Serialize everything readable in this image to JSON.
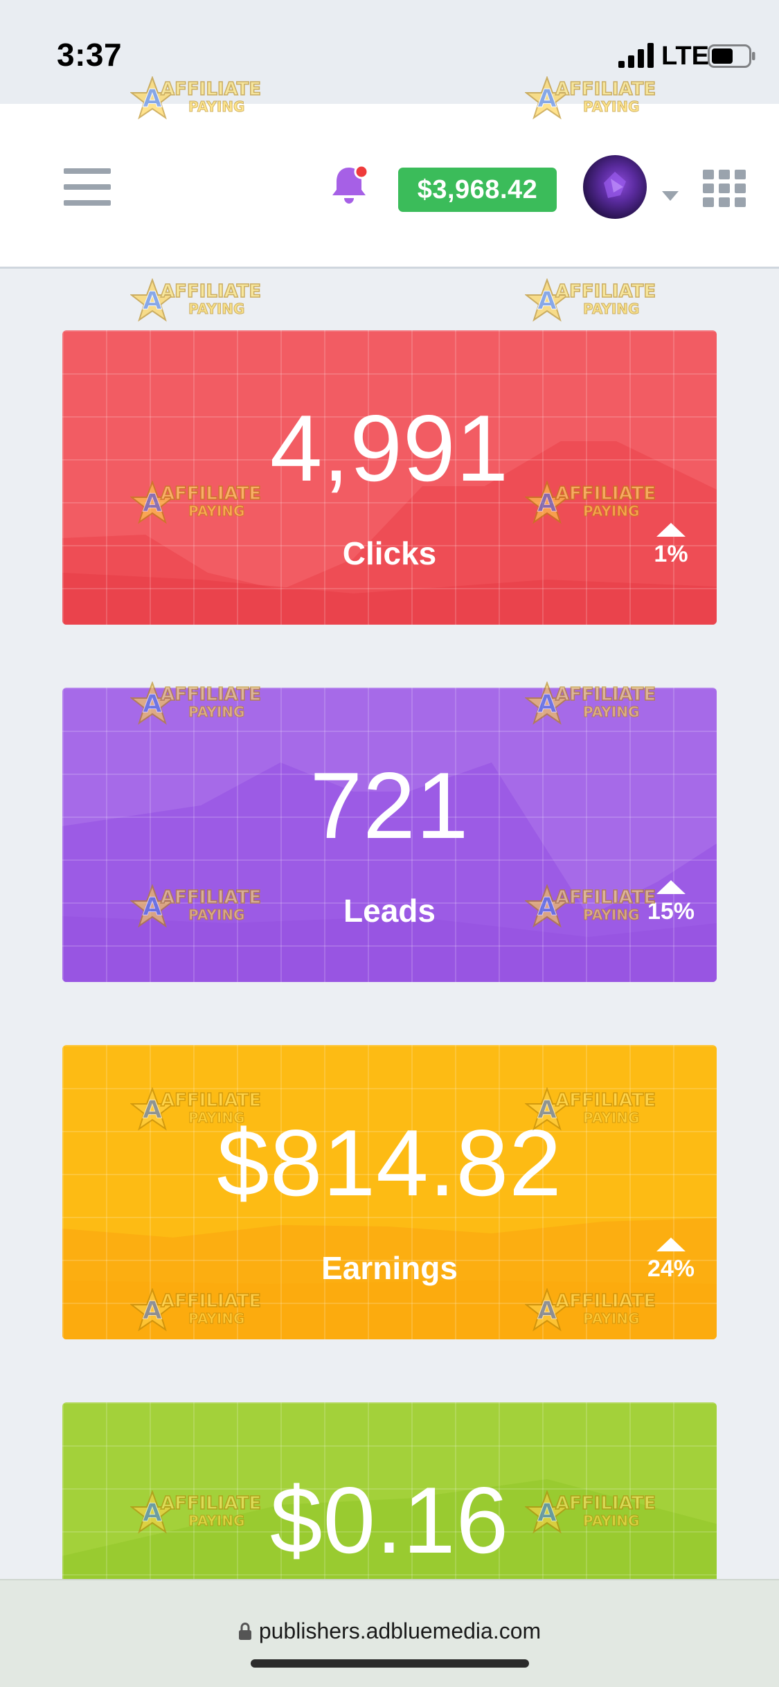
{
  "status_bar": {
    "time": "3:37",
    "network": "LTE",
    "icons": [
      "cellular-signal-icon",
      "battery-icon"
    ]
  },
  "header": {
    "menu_icon": "hamburger-menu-icon",
    "notification_icon": "bell-icon",
    "notification_color": "#a660e6",
    "balance": "$3,968.42",
    "balance_color": "#3bbc5a",
    "avatar": "user-avatar",
    "apps_icon": "grid-apps-icon"
  },
  "cards": [
    {
      "value": "4,991",
      "label": "Clicks",
      "trend": "1%",
      "trend_direction": "up",
      "color": "#f25c63"
    },
    {
      "value": "721",
      "label": "Leads",
      "trend": "15%",
      "trend_direction": "up",
      "color": "#a66ae8"
    },
    {
      "value": "$814.82",
      "label": "Earnings",
      "trend": "24%",
      "trend_direction": "up",
      "color": "#fdbb14"
    },
    {
      "value": "$0.16",
      "color": "#a3d13a"
    }
  ],
  "watermark": {
    "line1": "AFFILIATE",
    "line2": "PAYING"
  },
  "browser": {
    "url": "publishers.adbluemedia.com",
    "lock_icon": "lock-icon"
  }
}
